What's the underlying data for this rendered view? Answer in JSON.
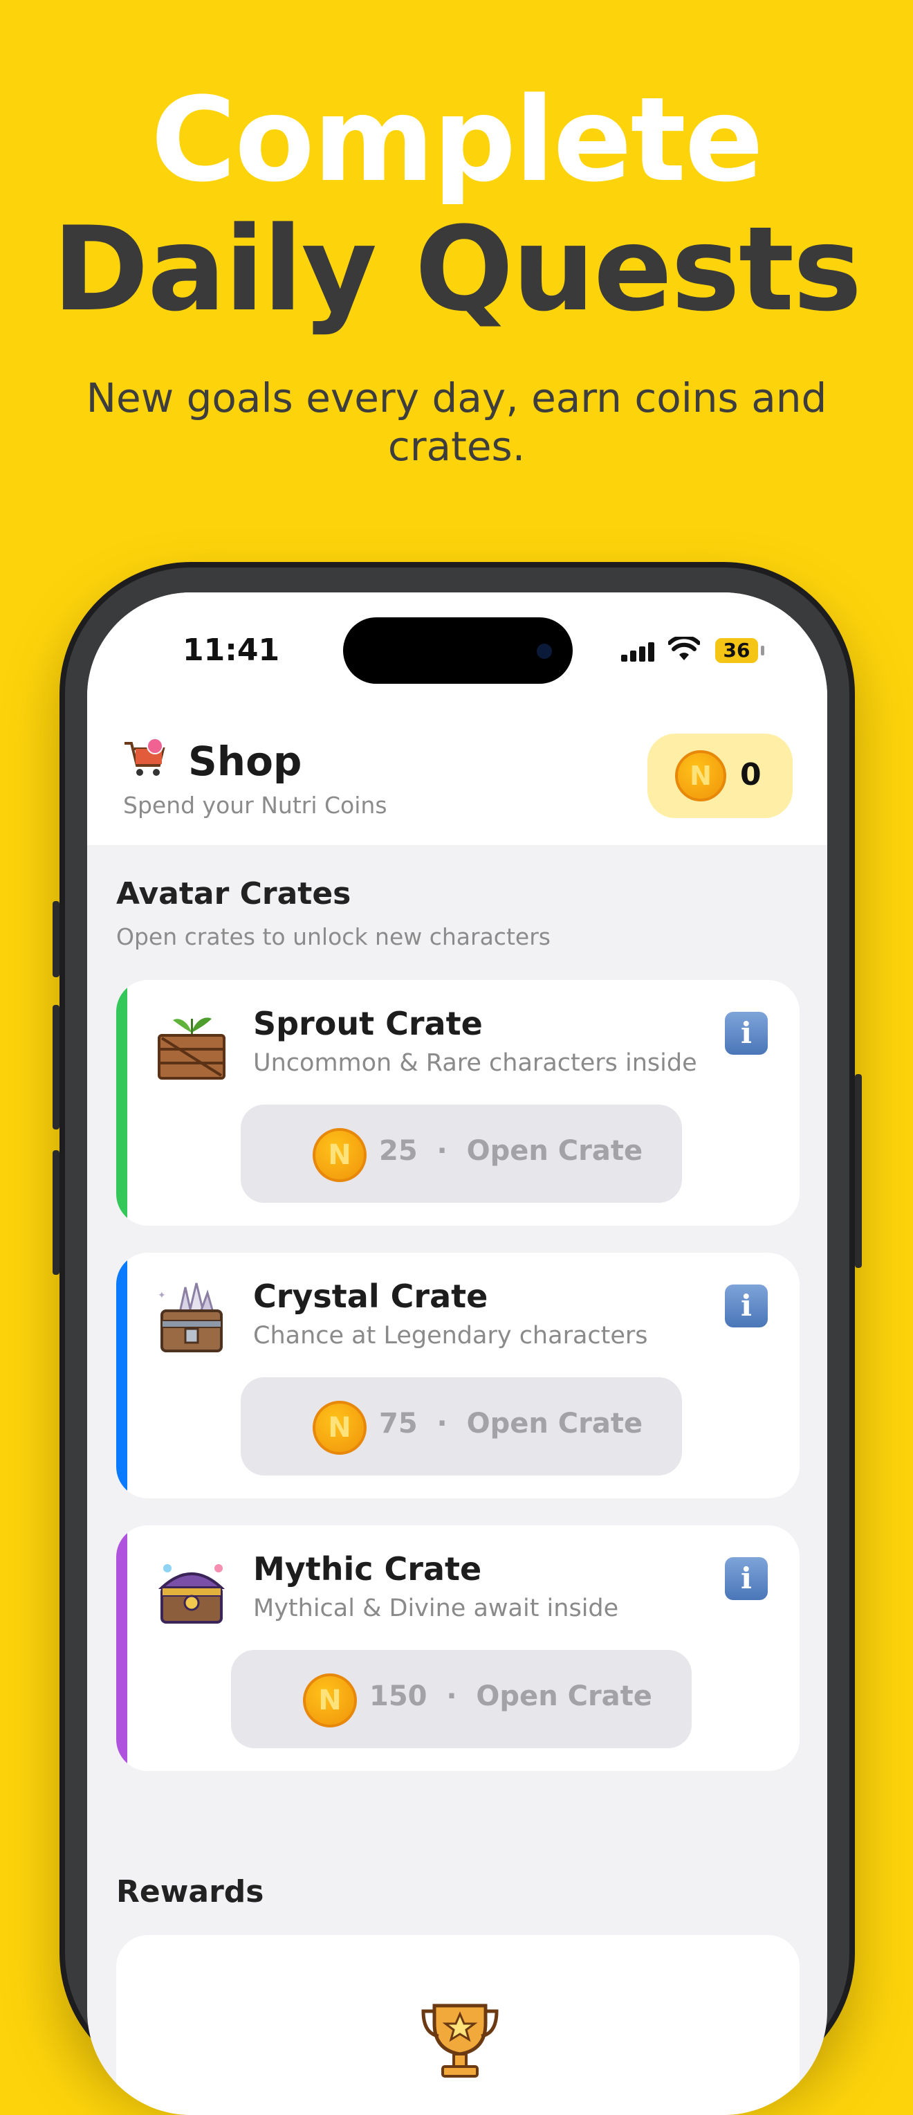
{
  "hero": {
    "line1": "Complete",
    "line2": "Daily Quests",
    "subtitle": "New goals every day, earn coins and crates."
  },
  "status_bar": {
    "time": "11:41",
    "battery": "36"
  },
  "header": {
    "title": "Shop",
    "subtitle": "Spend your Nutri Coins",
    "coin_symbol": "N",
    "coin_balance": "0"
  },
  "avatar_crates": {
    "title": "Avatar Crates",
    "subtitle": "Open crates to unlock new characters",
    "crates": [
      {
        "name": "Sprout Crate",
        "description": "Uncommon & Rare characters inside",
        "price": "25",
        "separator": "·",
        "action": "Open Crate",
        "accent": "#34C759",
        "icon": "sprout-crate-icon"
      },
      {
        "name": "Crystal Crate",
        "description": "Chance at Legendary characters",
        "price": "75",
        "separator": "·",
        "action": "Open Crate",
        "accent": "#0A7AFF",
        "icon": "crystal-crate-icon"
      },
      {
        "name": "Mythic Crate",
        "description": "Mythical & Divine await inside",
        "price": "150",
        "separator": "·",
        "action": "Open Crate",
        "accent": "#AF52DE",
        "icon": "mythic-crate-icon"
      }
    ]
  },
  "rewards": {
    "title": "Rewards",
    "icon": "trophy-icon"
  },
  "colors": {
    "background": "#FDD40B",
    "coin_pill": "#FFEFA6",
    "button_bg": "#E6E6EB",
    "button_text": "#A2A2A7"
  }
}
